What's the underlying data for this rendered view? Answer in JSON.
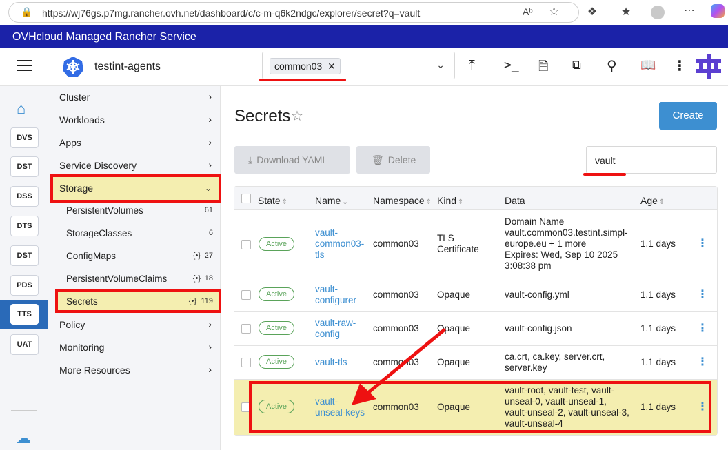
{
  "browser": {
    "url": "https://wj76gs.p7mg.rancher.ovh.net/dashboard/c/c-m-q6k2ndgc/explorer/secret?q=vault"
  },
  "banner": {
    "text": "OVHcloud Managed Rancher Service"
  },
  "header": {
    "cluster_name": "testint-agents",
    "namespace_chip": "common03"
  },
  "rail": {
    "clusters": [
      "DVS",
      "DST",
      "DSS",
      "DTS",
      "DST",
      "PDS",
      "TTS",
      "UAT"
    ],
    "active": "TTS"
  },
  "nav": {
    "items": {
      "cluster": "Cluster",
      "workloads": "Workloads",
      "apps": "Apps",
      "service_discovery": "Service Discovery",
      "storage": "Storage",
      "policy": "Policy",
      "monitoring": "Monitoring",
      "more_resources": "More Resources"
    },
    "storage_children": [
      {
        "label": "PersistentVolumes",
        "count": "61"
      },
      {
        "label": "StorageClasses",
        "count": "6"
      },
      {
        "label": "ConfigMaps",
        "count": "27"
      },
      {
        "label": "PersistentVolumeClaims",
        "count": "18"
      },
      {
        "label": "Secrets",
        "count": "119"
      }
    ]
  },
  "main": {
    "title": "Secrets",
    "create_label": "Create",
    "download_yaml_label": "Download YAML",
    "delete_label": "Delete",
    "search_value": "vault",
    "columns": {
      "state": "State",
      "name": "Name",
      "namespace": "Namespace",
      "kind": "Kind",
      "data": "Data",
      "age": "Age"
    },
    "rows": [
      {
        "state": "Active",
        "name": [
          "vault-",
          "common03-",
          "tls"
        ],
        "namespace": "common03",
        "kind": [
          "TLS",
          "Certificate"
        ],
        "data": [
          "Domain Name",
          "vault.common03.testint.simpl-",
          "europe.eu + 1 more",
          "Expires: Wed, Sep 10 2025",
          "3:08:38 pm"
        ],
        "age": "1.1 days"
      },
      {
        "state": "Active",
        "name": [
          "vault-",
          "configurer"
        ],
        "namespace": "common03",
        "kind": [
          "Opaque"
        ],
        "data": [
          "vault-config.yml"
        ],
        "age": "1.1 days"
      },
      {
        "state": "Active",
        "name": [
          "vault-raw-",
          "config"
        ],
        "namespace": "common03",
        "kind": [
          "Opaque"
        ],
        "data": [
          "vault-config.json"
        ],
        "age": "1.1 days"
      },
      {
        "state": "Active",
        "name": [
          "vault-tls"
        ],
        "namespace": "common03",
        "kind": [
          "Opaque"
        ],
        "data": [
          "ca.crt, ca.key, server.crt,",
          "server.key"
        ],
        "age": "1.1 days"
      },
      {
        "state": "Active",
        "name": [
          "vault-",
          "unseal-keys"
        ],
        "namespace": "common03",
        "kind": [
          "Opaque"
        ],
        "data": [
          "vault-root, vault-test, vault-",
          "unseal-0, vault-unseal-1,",
          "vault-unseal-2, vault-unseal-3,",
          "vault-unseal-4"
        ],
        "age": "1.1 days"
      }
    ]
  },
  "colors": {
    "banner": "#1b22a8",
    "accent": "#3d8fd1",
    "highlight": "#f4eeb0",
    "annotation": "#e11111",
    "active_green": "#5aa35a"
  }
}
